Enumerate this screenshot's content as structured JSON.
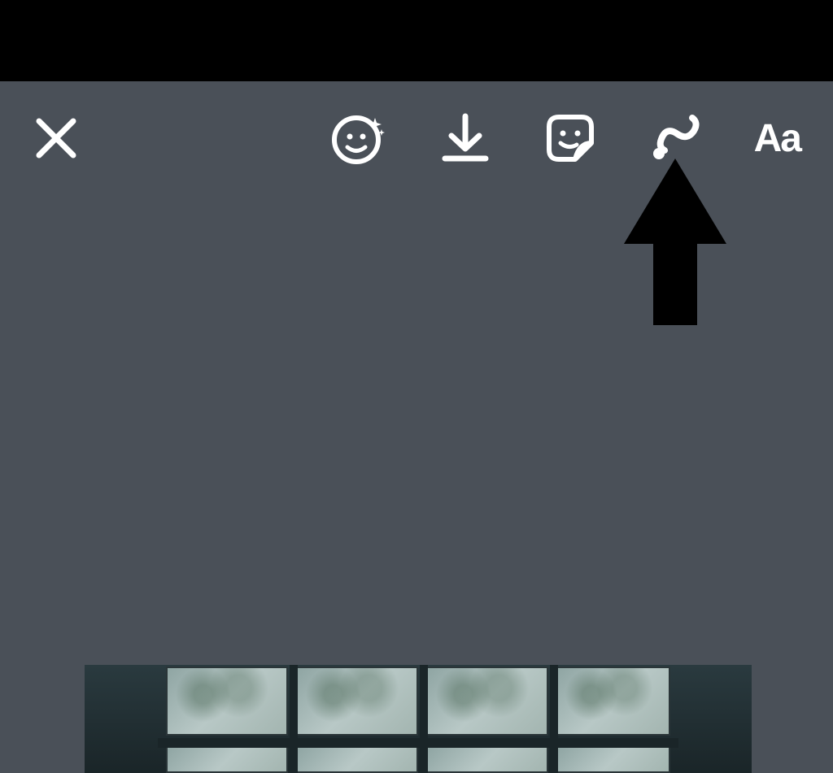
{
  "toolbar": {
    "close_icon": "close-icon",
    "effects_icon": "sparkle-face-icon",
    "download_icon": "download-icon",
    "sticker_icon": "sticker-icon",
    "draw_icon": "squiggle-draw-icon",
    "text_label": "Aa"
  },
  "annotation": {
    "type": "arrow-up",
    "points_to": "draw-icon"
  },
  "colors": {
    "background": "#4a5058",
    "status_bar": "#000000",
    "icon_stroke": "#ffffff",
    "annotation_fill": "#000000"
  }
}
